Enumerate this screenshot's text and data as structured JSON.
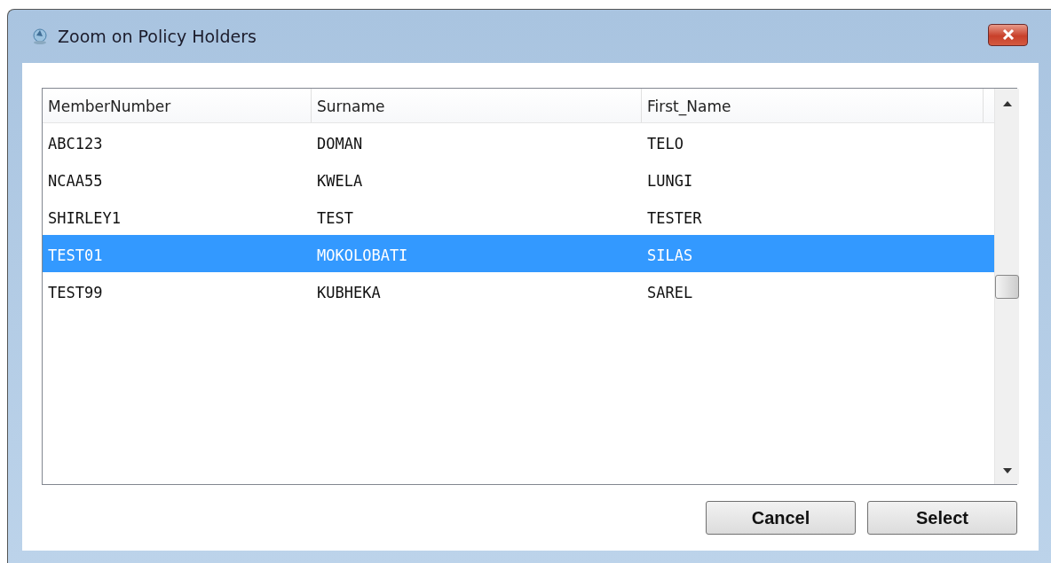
{
  "window": {
    "title": "Zoom on Policy Holders"
  },
  "table": {
    "columns": [
      "MemberNumber",
      "Surname",
      "First_Name"
    ],
    "rows": [
      {
        "cells": [
          "ABC123",
          "DOMAN",
          "TELO"
        ],
        "selected": false
      },
      {
        "cells": [
          "NCAA55",
          "KWELA",
          "LUNGI"
        ],
        "selected": false
      },
      {
        "cells": [
          "SHIRLEY1",
          "TEST",
          "TESTER"
        ],
        "selected": false
      },
      {
        "cells": [
          "TEST01",
          "MOKOLOBATI",
          "SILAS"
        ],
        "selected": true
      },
      {
        "cells": [
          "TEST99",
          "KUBHEKA",
          "SAREL"
        ],
        "selected": false
      }
    ]
  },
  "buttons": [
    "Cancel",
    "Select"
  ]
}
